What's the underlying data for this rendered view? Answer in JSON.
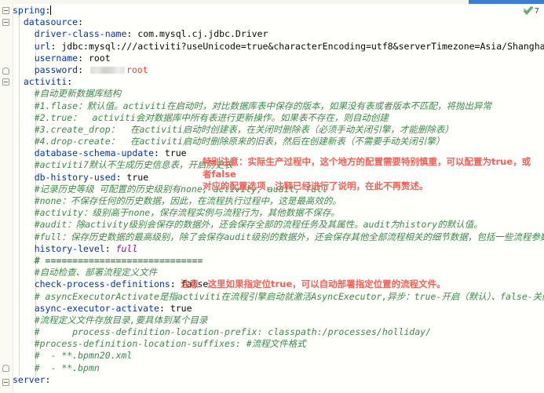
{
  "app": {
    "editor": "yaml-editor",
    "filename": "application.yml"
  },
  "colors": {
    "key": "#0033B3",
    "comment": "#3E8A4A",
    "string": "#067D17",
    "number": "#1750EB",
    "annotation_red": "#F2625A",
    "password_red": "#E2433A",
    "background": "#FFFFFC",
    "scrollbar_blue": "#3C7FD0"
  },
  "inspection_widget": {
    "icon": "green-check-icon",
    "count": "7"
  },
  "code_lines": [
    {
      "indent": 0,
      "type": "key",
      "key": "spring",
      "value": "",
      "caret": true
    },
    {
      "indent": 1,
      "type": "key",
      "key": "datasource",
      "value": ""
    },
    {
      "indent": 2,
      "type": "kv",
      "key": "driver-class-name",
      "value": "com.mysql.cj.jdbc.Driver"
    },
    {
      "indent": 2,
      "type": "kv",
      "key": "url",
      "value": "jdbc:mysql:///activiti?useUnicode=true&characterEncoding=utf8&serverTimezone=Asia/Shanghai"
    },
    {
      "indent": 2,
      "type": "kv",
      "key": "username",
      "value": "root"
    },
    {
      "indent": 2,
      "type": "password",
      "key": "password",
      "redacted_note": "root"
    },
    {
      "indent": 1,
      "type": "key",
      "key": "activiti",
      "value": ""
    },
    {
      "indent": 2,
      "type": "comment",
      "text": "#自动更新数据库结构"
    },
    {
      "indent": 2,
      "type": "comment",
      "text": "#1.flase：默认值。activiti在启动时，对比数据库表中保存的版本，如果没有表或者版本不匹配，将抛出异常"
    },
    {
      "indent": 2,
      "type": "comment",
      "text": "#2.true：  activiti会对数据库中所有表进行更新操作。如果表不存在，则自动创建"
    },
    {
      "indent": 2,
      "type": "comment",
      "text": "#3.create_drop：  在activiti启动时创建表，在关闭时删除表（必须手动关闭引擎，才能删除表）"
    },
    {
      "indent": 2,
      "type": "comment",
      "text": "#4.drop-create：  在activiti启动时删除原来的旧表，然后在创建新表（不需要手动关闭引擎）"
    },
    {
      "indent": 2,
      "type": "kv",
      "key": "database-schema-update",
      "value": "true"
    },
    {
      "indent": 2,
      "type": "comment",
      "text": "#activiti7默认不生成历史信息表，开启历史表"
    },
    {
      "indent": 2,
      "type": "kv",
      "key": "db-history-used",
      "value": "true"
    },
    {
      "indent": 2,
      "type": "comment",
      "text": "#记录历史等级 可配置的历史级别有none, activity, audit, full"
    },
    {
      "indent": 2,
      "type": "comment",
      "text": "#none：不保存任何的历史数据，因此，在流程执行过程中，这是最高效的。"
    },
    {
      "indent": 2,
      "type": "comment",
      "text": "#activity：级别高于none，保存流程实例与流程行为，其他数据不保存。"
    },
    {
      "indent": 2,
      "type": "comment",
      "text": "#audit：除activity级别会保存的数据外，还会保存全部的流程任务及其属性。audit为history的默认值。"
    },
    {
      "indent": 2,
      "type": "comment",
      "text": "#full：保存历史数据的最高级别，除了会保存audit级别的数据外，还会保存其他全部流程相关的细节数据，包括一些流程参数等。"
    },
    {
      "indent": 2,
      "type": "kv-anchor",
      "key": "history-level",
      "value": "full"
    },
    {
      "indent": 2,
      "type": "comment",
      "text": "# ============================="
    },
    {
      "indent": 2,
      "type": "comment",
      "text": "#自动检查、部署流程定义文件"
    },
    {
      "indent": 2,
      "type": "kv",
      "key": "check-process-definitions",
      "value": "false"
    },
    {
      "indent": 2,
      "type": "comment",
      "text": "# asyncExecutorActivate是指activiti在流程引擎启动就激活AsyncExecutor,异步：true-开启（默认）、false-关闭"
    },
    {
      "indent": 2,
      "type": "kv",
      "key": "async-executor-activate",
      "value": "true"
    },
    {
      "indent": 2,
      "type": "comment",
      "text": "#流程定义文件存放目录,要具体到某个目录"
    },
    {
      "indent": 2,
      "type": "comment",
      "text": "#      process-definition-location-prefix: classpath:/processes/holliday/"
    },
    {
      "indent": 2,
      "type": "comment",
      "text": "#process-definition-location-suffixes: #流程文件格式"
    },
    {
      "indent": 2,
      "type": "comment",
      "text": "#  - **.bpmn20.xml"
    },
    {
      "indent": 2,
      "type": "comment",
      "text": "#  - **.bpmn"
    },
    {
      "indent": 0,
      "type": "key",
      "key": "server",
      "value": ""
    }
  ],
  "annotations": [
    {
      "id": "annotation-database-schema",
      "text": "特别注意：实际生产过程中，这个地方的配置需要特别慎重，可以配置为true，或者false\n对应的配置选项，注释已经进行了说明，在此不再赘述。"
    },
    {
      "id": "annotation-check-process",
      "text": "注意：这里如果指定位true，可以自动部署指定位置的流程文件。"
    }
  ]
}
